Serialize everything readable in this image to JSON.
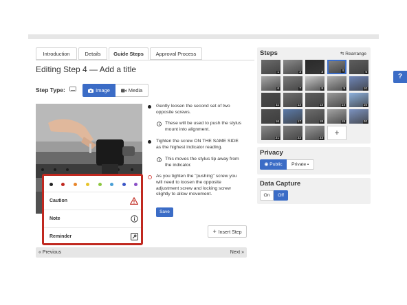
{
  "tabs": [
    {
      "label": "Introduction"
    },
    {
      "label": "Details"
    },
    {
      "label": "Guide Steps"
    },
    {
      "label": "Approval Process"
    }
  ],
  "page_title": "Editing Step 4 — Add a title",
  "step_type": {
    "label": "Step Type:",
    "image": "Image",
    "media": "Media"
  },
  "bullets": [
    {
      "text": "Gently loosen the second set of two opposite screws.",
      "color": "#222222",
      "level": 0
    },
    {
      "text": "These will be used to push the stylus mount into alignment.",
      "icon": "info-icon",
      "level": 1
    },
    {
      "text": "Tighten the screw ON THE SAME SIDE as the highest indicator reading.",
      "color": "#222222",
      "level": 0
    },
    {
      "text": "This moves the stylus tip away from the indicator.",
      "icon": "info-icon",
      "level": 1
    },
    {
      "text": "As you tighten the \"pushing\" screw you will need to loosen the opposite adjustment screw and locking screw slightly to allow movement.",
      "color": "#d9534f",
      "level": 0
    }
  ],
  "save": "Save",
  "insert_step": "Insert Step",
  "pager": {
    "prev": "« Previous",
    "next": "Next »"
  },
  "popup": {
    "colors": [
      "#222222",
      "#c0281f",
      "#e8862a",
      "#e8c42a",
      "#8cc63f",
      "#4a9fd6",
      "#3b55c6",
      "#8a4fc6"
    ],
    "items": [
      {
        "label": "Caution",
        "icon": "warning-icon",
        "icon_color": "#c0281f"
      },
      {
        "label": "Note",
        "icon": "info-icon",
        "icon_color": "#333333"
      },
      {
        "label": "Reminder",
        "icon": "pin-icon",
        "icon_color": "#333333"
      }
    ]
  },
  "steps": {
    "title": "Steps",
    "rearrange": "Rearrange",
    "numbers": [
      "1",
      "2",
      "3",
      "4",
      "5",
      "6",
      "7",
      "8",
      "9",
      "10",
      "11",
      "12",
      "13",
      "14",
      "15",
      "16",
      "17",
      "18",
      "19",
      "20",
      "21",
      "22",
      "23"
    ],
    "add": "+"
  },
  "privacy": {
    "title": "Privacy",
    "public": "Public",
    "private": "Private"
  },
  "data_capture": {
    "title": "Data Capture",
    "on": "On",
    "off": "Off"
  },
  "help": "?",
  "colors": {
    "accent": "#3b6cc6",
    "popup_border": "#c0281f"
  }
}
